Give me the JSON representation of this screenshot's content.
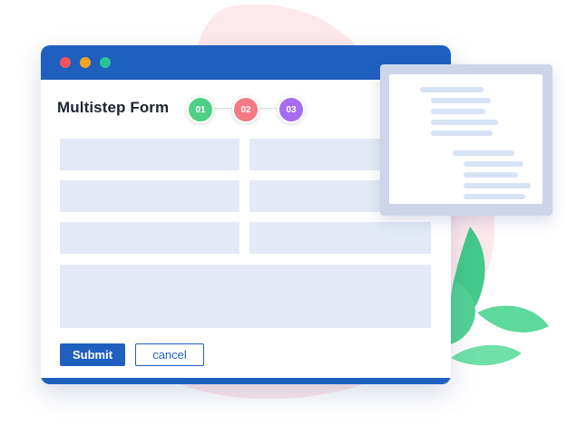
{
  "form": {
    "title": "Multistep Form",
    "steps": [
      {
        "label": "01",
        "color": "#4fcf86"
      },
      {
        "label": "02",
        "color": "#f47b82"
      },
      {
        "label": "03",
        "color": "#a66cf0"
      }
    ],
    "submit_label": "Submit",
    "cancel_label": "cancel"
  },
  "colors": {
    "accent": "#1f5fbf",
    "field_fill": "#e3eaf5",
    "preview_frame": "#cfd5e8",
    "preview_line": "#d7e3f5",
    "blob": "#fde8eb",
    "leaf": "#43c98a",
    "window_dots": [
      "#f2555a",
      "#f6a521",
      "#27c39a"
    ]
  }
}
